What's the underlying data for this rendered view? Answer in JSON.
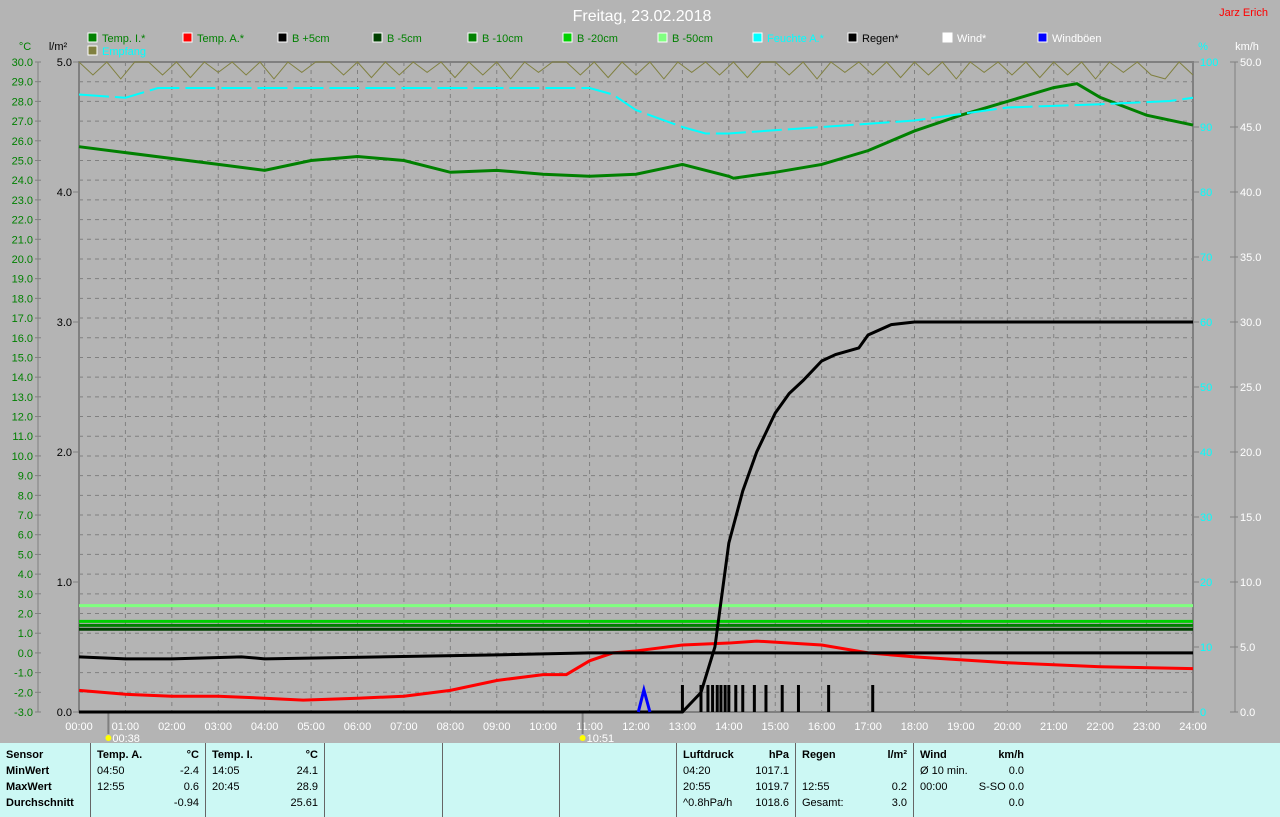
{
  "title": "Freitag, 23.02.2018",
  "author": "Jarz Erich",
  "legend": [
    {
      "label": "Temp. I.*",
      "color": "#008000",
      "text": "#008000"
    },
    {
      "label": "Temp. A.*",
      "color": "#ff0000",
      "text": "#008000"
    },
    {
      "label": "B +5cm",
      "color": "#000000",
      "text": "#008000"
    },
    {
      "label": "B -5cm",
      "color": "#004000",
      "text": "#008000"
    },
    {
      "label": "B -10cm",
      "color": "#008000",
      "text": "#008000"
    },
    {
      "label": "B -20cm",
      "color": "#00d000",
      "text": "#008000"
    },
    {
      "label": "B -50cm",
      "color": "#80ff80",
      "text": "#008000"
    },
    {
      "label": "Feuchte A.*",
      "color": "#00ffff",
      "text": "#00ffff"
    },
    {
      "label": "Regen*",
      "color": "#000000",
      "text": "#000000"
    },
    {
      "label": "Wind*",
      "color": "#ffffff",
      "text": "#ffffff"
    },
    {
      "label": "Windböen",
      "color": "#0000ff",
      "text": "#ffffff"
    },
    {
      "label": "Empfang",
      "color": "#808040",
      "text": "#00ffff"
    }
  ],
  "axes": {
    "temp_unit": "°C",
    "rain_unit": "l/m²",
    "hum_unit": "%",
    "wind_unit": "km/h",
    "temp_ticks": [
      "30.0",
      "29.0",
      "28.0",
      "27.0",
      "26.0",
      "25.0",
      "24.0",
      "23.0",
      "22.0",
      "21.0",
      "20.0",
      "19.0",
      "18.0",
      "17.0",
      "16.0",
      "15.0",
      "14.0",
      "13.0",
      "12.0",
      "11.0",
      "10.0",
      "9.0",
      "8.0",
      "7.0",
      "6.0",
      "5.0",
      "4.0",
      "3.0",
      "2.0",
      "1.0",
      "0.0",
      "-1.0",
      "-2.0",
      "-3.0"
    ],
    "rain_ticks": [
      "5.0",
      "4.0",
      "3.0",
      "2.0",
      "1.0",
      "0.0"
    ],
    "hum_ticks": [
      "100",
      "90",
      "80",
      "70",
      "60",
      "50",
      "40",
      "30",
      "20",
      "10",
      "0"
    ],
    "wind_ticks": [
      "50.0",
      "45.0",
      "40.0",
      "35.0",
      "30.0",
      "25.0",
      "20.0",
      "15.0",
      "10.0",
      "5.0",
      "0.0"
    ],
    "x_ticks": [
      "00:00",
      "01:00",
      "02:00",
      "03:00",
      "04:00",
      "05:00",
      "06:00",
      "07:00",
      "08:00",
      "09:00",
      "10:00",
      "11:00",
      "12:00",
      "13:00",
      "14:00",
      "15:00",
      "16:00",
      "17:00",
      "18:00",
      "19:00",
      "20:00",
      "21:00",
      "22:00",
      "23:00",
      "24:00"
    ],
    "sunrise": "00:38",
    "sunset": "10:51"
  },
  "chart_data": {
    "type": "line",
    "title": "Freitag, 23.02.2018",
    "xlabel": "",
    "ylabel": "°C",
    "xlim": [
      0,
      24
    ],
    "ylim_temp": [
      -3,
      30
    ],
    "ylim_rain": [
      0,
      5
    ],
    "ylim_hum": [
      0,
      100
    ],
    "ylim_wind": [
      0,
      50
    ],
    "grid": true,
    "series": [
      {
        "name": "Temp. I.*",
        "axis": "temp",
        "color": "#008000",
        "x": [
          0,
          1,
          2,
          3,
          4,
          5,
          6,
          7,
          8,
          9,
          10,
          11,
          12,
          13,
          14,
          14.1,
          15,
          16,
          17,
          18,
          19,
          20,
          21,
          21.5,
          22,
          23,
          24
        ],
        "y": [
          25.7,
          25.4,
          25.1,
          24.8,
          24.5,
          25.0,
          25.2,
          25.0,
          24.4,
          24.5,
          24.3,
          24.2,
          24.3,
          24.8,
          24.2,
          24.1,
          24.4,
          24.8,
          25.5,
          26.5,
          27.3,
          28.0,
          28.7,
          28.9,
          28.2,
          27.3,
          26.8
        ]
      },
      {
        "name": "Temp. A.*",
        "axis": "temp",
        "color": "#ff0000",
        "x": [
          0,
          1,
          2,
          3,
          4,
          4.83,
          6,
          7,
          8,
          9,
          10,
          10.5,
          11,
          11.5,
          12,
          13,
          14,
          14.6,
          16,
          17,
          18,
          20,
          22,
          24
        ],
        "y": [
          -1.9,
          -2.1,
          -2.2,
          -2.2,
          -2.3,
          -2.4,
          -2.3,
          -2.2,
          -1.9,
          -1.4,
          -1.1,
          -1.1,
          -0.4,
          0.0,
          0.1,
          0.4,
          0.5,
          0.6,
          0.4,
          0.0,
          -0.2,
          -0.5,
          -0.7,
          -0.8
        ]
      },
      {
        "name": "B +5cm",
        "axis": "temp",
        "color": "#000000",
        "x": [
          0,
          1,
          2,
          3.5,
          4,
          9,
          11,
          24
        ],
        "y": [
          -0.2,
          -0.3,
          -0.3,
          -0.2,
          -0.3,
          -0.1,
          0.0,
          0.0
        ]
      },
      {
        "name": "B -5cm",
        "axis": "temp",
        "color": "#004000",
        "x": [
          0,
          24
        ],
        "y": [
          1.2,
          1.2
        ]
      },
      {
        "name": "B -10cm",
        "axis": "temp",
        "color": "#008000",
        "x": [
          0,
          24
        ],
        "y": [
          1.4,
          1.4
        ]
      },
      {
        "name": "B -20cm",
        "axis": "temp",
        "color": "#00d000",
        "x": [
          0,
          24
        ],
        "y": [
          1.6,
          1.6
        ]
      },
      {
        "name": "B -50cm",
        "axis": "temp",
        "color": "#80ff80",
        "x": [
          0,
          24
        ],
        "y": [
          2.4,
          2.4
        ]
      },
      {
        "name": "Feuchte A.*",
        "axis": "hum",
        "color": "#00ffff",
        "x": [
          0,
          1,
          1.7,
          11,
          11.5,
          12,
          13,
          13.5,
          14,
          16,
          18,
          20,
          22,
          23.5,
          24
        ],
        "y": [
          95,
          94.5,
          96,
          96,
          95,
          92.6,
          90,
          89,
          89,
          90,
          91,
          93,
          93.5,
          94,
          94.5
        ]
      },
      {
        "name": "Regen*",
        "axis": "rain",
        "color": "#000000",
        "x": [
          0,
          13,
          13.4,
          13.7,
          13.85,
          14,
          14.3,
          14.6,
          15,
          15.3,
          15.6,
          16,
          16.3,
          16.8,
          17,
          17.5,
          18,
          24
        ],
        "y": [
          0,
          0,
          0.15,
          0.5,
          0.9,
          1.3,
          1.7,
          2.0,
          2.3,
          2.45,
          2.55,
          2.7,
          2.75,
          2.8,
          2.9,
          2.98,
          3.0,
          3.0
        ]
      },
      {
        "name": "Windböen",
        "axis": "wind",
        "color": "#0000ff",
        "x": [
          12.05,
          12.17,
          12.3
        ],
        "y": [
          0,
          1.7,
          0
        ]
      },
      {
        "name": "Empfang",
        "axis": "rain",
        "color": "#808040",
        "x": [
          0,
          0.3,
          0.6,
          0.9,
          1.2,
          1.5,
          1.8,
          2.1,
          2.4,
          2.7,
          3,
          3.3,
          3.6,
          3.9,
          4.2,
          4.5,
          4.8,
          5.1,
          5.4,
          5.7,
          6,
          6.3,
          6.6,
          6.9,
          7.2,
          7.5,
          7.8,
          8.1,
          8.4,
          8.7,
          9,
          9.3,
          9.6,
          9.9,
          10.2,
          10.5,
          10.8,
          11.1,
          11.4,
          11.7,
          12,
          12.3,
          12.6,
          12.9,
          13.2,
          13.5,
          13.8,
          14.1,
          14.4,
          14.7,
          15,
          15.3,
          15.6,
          15.9,
          16.2,
          16.5,
          16.8,
          17.1,
          17.4,
          17.7,
          18,
          18.3,
          18.6,
          18.9,
          19.2,
          19.5,
          19.8,
          20.1,
          20.4,
          20.7,
          21,
          21.3,
          21.6,
          21.9,
          22.2,
          22.5,
          22.8,
          23.1,
          23.4,
          23.7,
          24
        ],
        "y": [
          5,
          4.9,
          5,
          4.87,
          5,
          5,
          4.9,
          5,
          4.88,
          5,
          4.92,
          5,
          4.9,
          5,
          4.87,
          5,
          4.92,
          5,
          5,
          4.9,
          5,
          4.88,
          5,
          4.9,
          5,
          4.92,
          5,
          4.88,
          5,
          4.9,
          5,
          4.87,
          5,
          4.92,
          5,
          5,
          4.9,
          5,
          4.88,
          5,
          4.9,
          5,
          4.87,
          5,
          4.92,
          5,
          4.9,
          5,
          4.88,
          5,
          5,
          4.9,
          5,
          4.87,
          5,
          4.92,
          5,
          4.9,
          5,
          4.88,
          5,
          4.9,
          5,
          4.87,
          5,
          4.92,
          5,
          4.9,
          5,
          4.88,
          5,
          4.9,
          5,
          4.87,
          5,
          4.92,
          5,
          4.9,
          4.87,
          5,
          4.9
        ]
      }
    ],
    "rain_events": [
      13.0,
      13.4,
      13.55,
      13.65,
      13.75,
      13.83,
      13.92,
      14.0,
      14.15,
      14.3,
      14.55,
      14.8,
      15.15,
      15.5,
      16.15,
      17.1
    ]
  },
  "stats": {
    "labels": {
      "sensor": "Sensor",
      "min": "MinWert",
      "max": "MaxWert",
      "avg": "Durchschnitt"
    },
    "temp_a": {
      "title": "Temp. A.",
      "unit": "°C",
      "min_t": "04:50",
      "min": "-2.4",
      "max_t": "12:55",
      "max": "0.6",
      "avg": "-0.94"
    },
    "temp_i": {
      "title": "Temp. I.",
      "unit": "°C",
      "min_t": "14:05",
      "min": "24.1",
      "max_t": "20:45",
      "max": "28.9",
      "avg": "25.61"
    },
    "pressure": {
      "title": "Luftdruck",
      "unit": "hPa",
      "min_t": "04:20",
      "min": "1017.1",
      "max_t": "20:55",
      "max": "1019.7",
      "trend": "^0.8hPa/h",
      "cur": "1018.6"
    },
    "rain": {
      "title": "Regen",
      "unit": "l/m²",
      "max_t": "12:55",
      "max": "0.2",
      "total_label": "Gesamt:",
      "total": "3.0"
    },
    "wind": {
      "title": "Wind",
      "unit": "km/h",
      "avg_label": "Ø 10 min.",
      "avg": "0.0",
      "max_t": "00:00",
      "max": "S-SO 0.0",
      "last": "0.0"
    }
  }
}
